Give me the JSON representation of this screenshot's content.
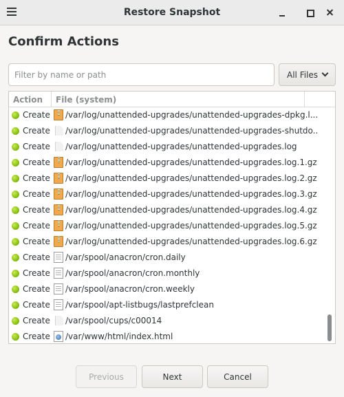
{
  "window": {
    "title": "Restore Snapshot"
  },
  "heading": "Confirm Actions",
  "filter": {
    "placeholder": "Filter by name or path",
    "value": ""
  },
  "files_dropdown": {
    "selected": "All Files"
  },
  "table": {
    "columns": [
      "Action",
      "File (system)"
    ],
    "rows": [
      {
        "action": "Create",
        "icon": "archive-file-icon",
        "path": "/var/log/unattended-upgrades/unattended-upgrades-dpkg.l..."
      },
      {
        "action": "Create",
        "icon": "blank-file-icon",
        "path": "/var/log/unattended-upgrades/unattended-upgrades-shutdo..."
      },
      {
        "action": "Create",
        "icon": "blank-file-icon",
        "path": "/var/log/unattended-upgrades/unattended-upgrades.log"
      },
      {
        "action": "Create",
        "icon": "archive-file-icon",
        "path": "/var/log/unattended-upgrades/unattended-upgrades.log.1.gz"
      },
      {
        "action": "Create",
        "icon": "archive-file-icon",
        "path": "/var/log/unattended-upgrades/unattended-upgrades.log.2.gz"
      },
      {
        "action": "Create",
        "icon": "archive-file-icon",
        "path": "/var/log/unattended-upgrades/unattended-upgrades.log.3.gz"
      },
      {
        "action": "Create",
        "icon": "archive-file-icon",
        "path": "/var/log/unattended-upgrades/unattended-upgrades.log.4.gz"
      },
      {
        "action": "Create",
        "icon": "archive-file-icon",
        "path": "/var/log/unattended-upgrades/unattended-upgrades.log.5.gz"
      },
      {
        "action": "Create",
        "icon": "archive-file-icon",
        "path": "/var/log/unattended-upgrades/unattended-upgrades.log.6.gz"
      },
      {
        "action": "Create",
        "icon": "text-file-icon",
        "path": "/var/spool/anacron/cron.daily"
      },
      {
        "action": "Create",
        "icon": "text-file-icon",
        "path": "/var/spool/anacron/cron.monthly"
      },
      {
        "action": "Create",
        "icon": "text-file-icon",
        "path": "/var/spool/anacron/cron.weekly"
      },
      {
        "action": "Create",
        "icon": "text-file-icon",
        "path": "/var/spool/apt-listbugs/lastprefclean"
      },
      {
        "action": "Create",
        "icon": "blank-file-icon",
        "path": "/var/spool/cups/c00014"
      },
      {
        "action": "Create",
        "icon": "html-file-icon",
        "path": "/var/www/html/index.html"
      }
    ]
  },
  "buttons": {
    "previous": "Previous",
    "next": "Next",
    "cancel": "Cancel"
  },
  "colors": {
    "status_create": "#7fb80e",
    "archive_icon": "#f0a94c"
  }
}
